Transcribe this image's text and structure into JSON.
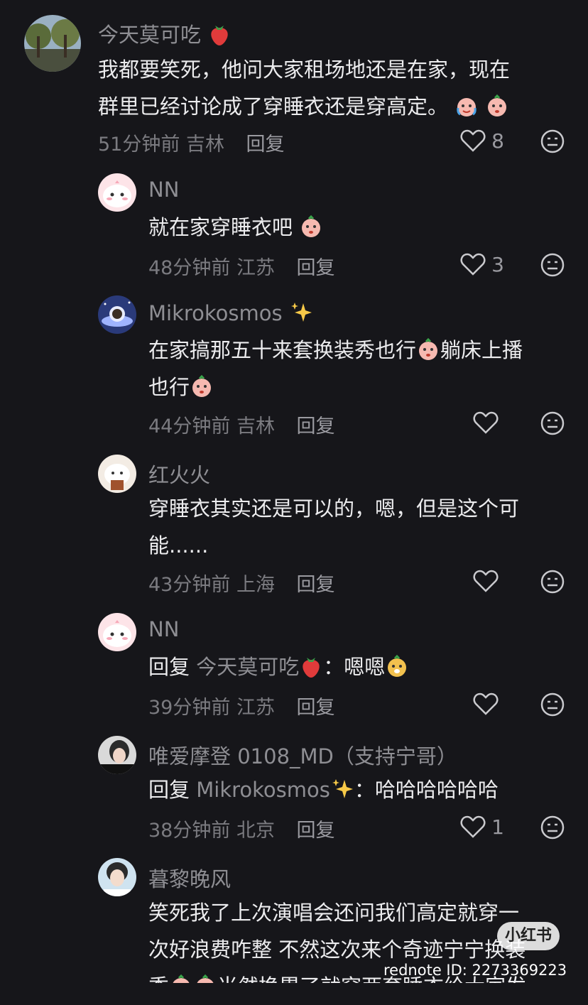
{
  "comments": [
    {
      "name": "今天莫可吃",
      "text_lines": [
        "我都要笑死，他问大家租场地还是在家，现在",
        "群里已经讨论成了穿睡衣还是穿高定。"
      ],
      "time": "51分钟前",
      "location": "吉林",
      "reply_label": "回复",
      "likes": "8"
    },
    {
      "name": "NN",
      "text_lines": [
        "就在家穿睡衣吧"
      ],
      "time": "48分钟前",
      "location": "江苏",
      "reply_label": "回复",
      "likes": "3"
    },
    {
      "name": "Mikrokosmos",
      "text_lines": [
        "在家搞那五十来套换装秀也行",
        "躺床上播",
        "也行"
      ],
      "time": "44分钟前",
      "location": "吉林",
      "reply_label": "回复",
      "likes": ""
    },
    {
      "name": "红火火",
      "text_lines": [
        "穿睡衣其实还是可以的，嗯，但是这个可",
        "能......"
      ],
      "time": "43分钟前",
      "location": "上海",
      "reply_label": "回复",
      "likes": ""
    },
    {
      "name": "NN",
      "reply_prefix": "回复",
      "mention": "今天莫可吃",
      "text_after": "：嗯嗯",
      "time": "39分钟前",
      "location": "江苏",
      "reply_label": "回复",
      "likes": ""
    },
    {
      "name": "唯爱摩登 0108_MD（支持宁哥）",
      "reply_prefix": "回复",
      "mention": "Mikrokosmos",
      "text_after": "：哈哈哈哈哈哈",
      "time": "38分钟前",
      "location": "北京",
      "reply_label": "回复",
      "likes": "1"
    },
    {
      "name": "暮黎晚风",
      "text_lines": [
        "笑死我了上次演唱会还问我们高定就穿一",
        "次好浪费咋整 不然这次来个奇迹宁宁换装",
        "秀",
        "当然换累了就穿两套睡衣给大家发"
      ]
    }
  ],
  "watermark": {
    "logo": "小红书",
    "id": "rednote ID: 2273369223"
  }
}
